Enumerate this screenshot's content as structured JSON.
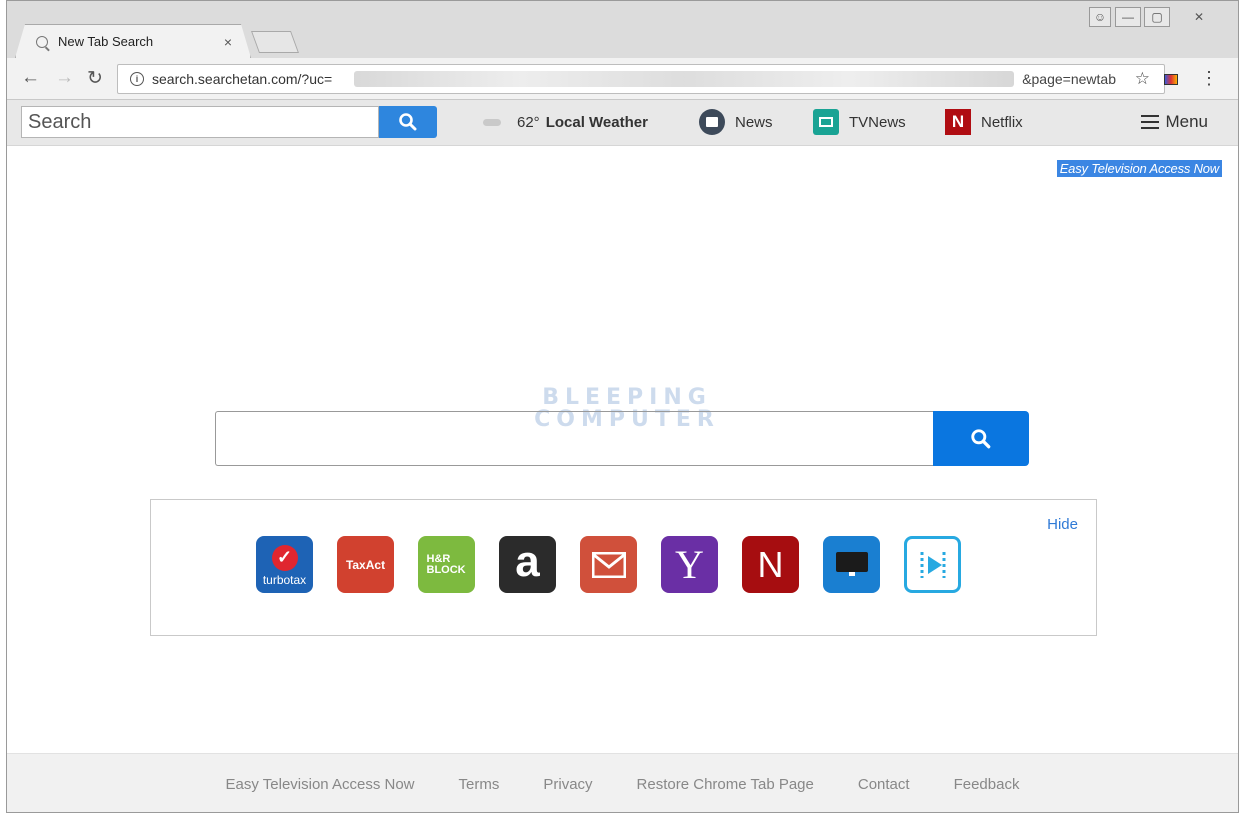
{
  "browser": {
    "tab_title": "New Tab Search",
    "tab_close": "×",
    "url_visible": "search.searchetan.com/?uc=",
    "url_tail": "&page=newtab"
  },
  "extbar": {
    "search_placeholder": "Search",
    "weather_temp": "62°",
    "weather_label": "Local Weather",
    "items": [
      {
        "label": "News"
      },
      {
        "label": "TVNews"
      },
      {
        "label": "Netflix"
      }
    ],
    "menu_label": "Menu"
  },
  "page": {
    "promo_link": "Easy Television Access Now",
    "watermark_line1": "BLEEPING",
    "watermark_line2": "COMPUTER",
    "hide_label": "Hide",
    "apps": [
      {
        "name": "TurboTax",
        "text": "turbotax",
        "color": "#1e63b5"
      },
      {
        "name": "TaxAct",
        "text": "TaxAct",
        "color": "#d1412f"
      },
      {
        "name": "H&R Block",
        "text": "H&R BLOCK",
        "color": "#7dba3f"
      },
      {
        "name": "Amazon",
        "text": "a",
        "color": "#2b2b2b"
      },
      {
        "name": "Gmail",
        "text": "",
        "color": "#d0503b"
      },
      {
        "name": "Yahoo",
        "text": "Y",
        "color": "#6a2fa5"
      },
      {
        "name": "Netflix",
        "text": "N",
        "color": "#a60d10"
      },
      {
        "name": "TV",
        "text": "",
        "color": "#1a7fd1"
      },
      {
        "name": "Video",
        "text": "",
        "color": "#ffffff"
      }
    ]
  },
  "footer": {
    "links": [
      "Easy Television Access Now",
      "Terms",
      "Privacy",
      "Restore Chrome Tab Page",
      "Contact",
      "Feedback"
    ]
  }
}
